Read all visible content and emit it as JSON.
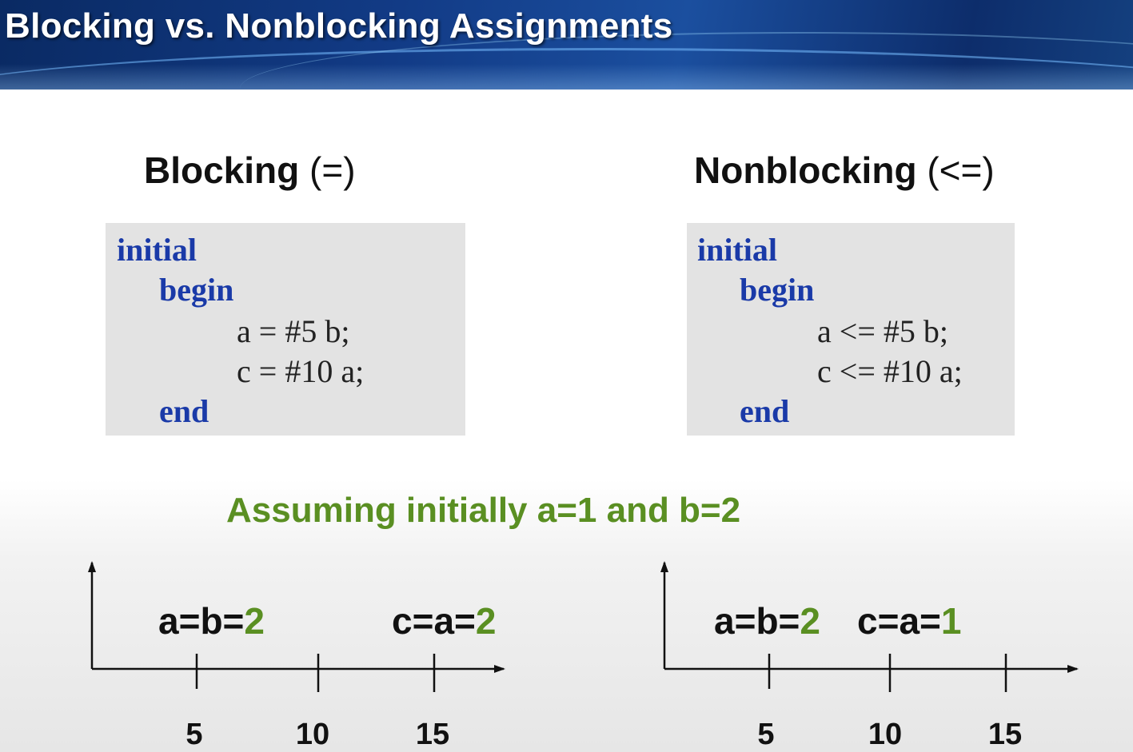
{
  "slide": {
    "title": "Blocking vs. Nonblocking Assignments",
    "note": "Assuming initially a=1 and b=2"
  },
  "blocking": {
    "heading": "Blocking",
    "operator": "(=)",
    "code": {
      "kw_initial": "initial",
      "kw_begin": "begin",
      "line1": "a = #5 b;",
      "line2": "c = #10 a;",
      "kw_end": "end"
    },
    "timeline": {
      "ticks": [
        "5",
        "10",
        "15"
      ],
      "events": [
        {
          "expr": "a=b=",
          "value": "2",
          "at": 5
        },
        {
          "expr": "c=a=",
          "value": "2",
          "at": 15
        }
      ]
    }
  },
  "nonblocking": {
    "heading": "Nonblocking",
    "operator": "(<=)",
    "code": {
      "kw_initial": "initial",
      "kw_begin": "begin",
      "line1": "a <= #5 b;",
      "line2": "c <= #10 a;",
      "kw_end": "end"
    },
    "timeline": {
      "ticks": [
        "5",
        "10",
        "15"
      ],
      "events": [
        {
          "expr": "a=b=",
          "value": "2",
          "at": 5
        },
        {
          "expr": "c=a=",
          "value": "1",
          "at": 10
        }
      ]
    }
  },
  "colors": {
    "keyword": "#1a3aa8",
    "highlight": "#5a8f22",
    "codebox": "#e3e3e3",
    "banner": "#123b86"
  }
}
